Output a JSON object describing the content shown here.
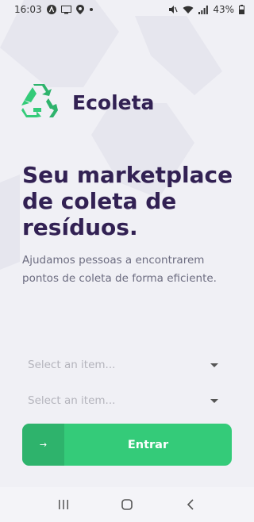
{
  "status_bar": {
    "time": "16:03",
    "battery": "43%",
    "left_icons": [
      "app-a-icon",
      "screen-cast-icon",
      "location-pin-icon",
      "dot-icon"
    ],
    "right_icons": [
      "mute-icon",
      "wifi-icon",
      "signal-icon",
      "battery-icon"
    ]
  },
  "logo": {
    "text": "Ecoleta",
    "icon": "recycle-icon",
    "color": "#34cb79"
  },
  "hero": {
    "title": "Seu marketplace de coleta de resíduos.",
    "subtitle": "Ajudamos pessoas a encontrarem pontos de coleta de forma eficiente."
  },
  "selects": [
    {
      "placeholder": "Select an item..."
    },
    {
      "placeholder": "Select an item..."
    }
  ],
  "enter_button": {
    "label": "Entrar",
    "icon": "arrow-right-icon",
    "arrow_glyph": "→"
  },
  "nav_bar": {
    "items": [
      "recent-apps-icon",
      "home-icon",
      "back-icon"
    ]
  },
  "colors": {
    "background": "#f0f0f5",
    "title": "#322153",
    "text": "#6c6c80",
    "primary": "#34cb79",
    "primary_dark": "#2eb36c"
  }
}
